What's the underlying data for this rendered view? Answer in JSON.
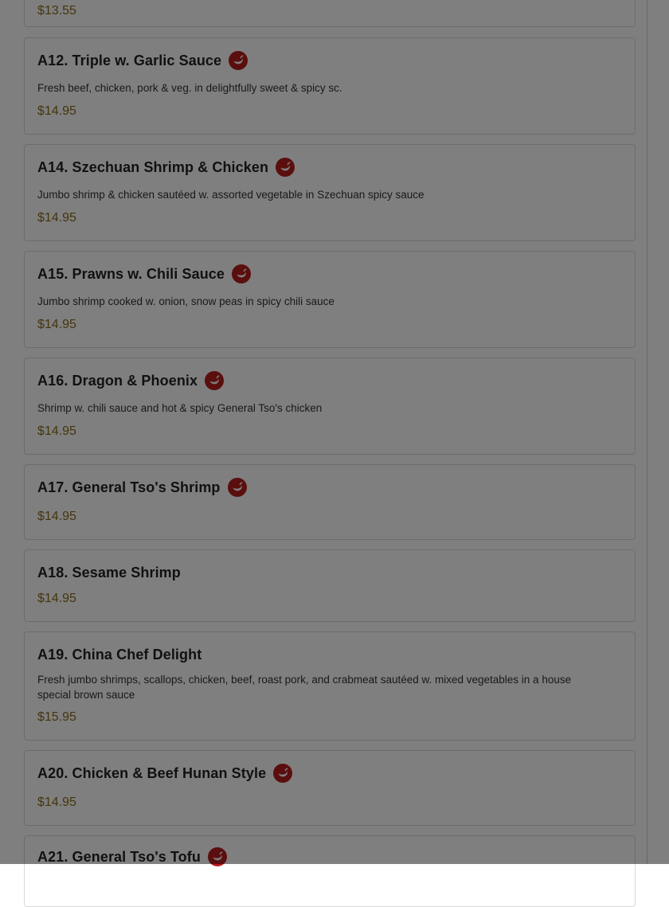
{
  "colors": {
    "price": "#8a6a1c",
    "spicy_icon": "#b71c1c",
    "overlay": "rgba(0,0,0,0.5)"
  },
  "menu": {
    "items": [
      {
        "name": "",
        "description": "",
        "price": "$13.55",
        "spicy": false
      },
      {
        "name": "A12. Triple w. Garlic Sauce",
        "description": "Fresh beef, chicken, pork & veg. in delightfully sweet & spicy sc.",
        "price": "$14.95",
        "spicy": true,
        "icon": "chili-pepper-icon"
      },
      {
        "name": "A14. Szechuan Shrimp & Chicken",
        "description": "Jumbo shrimp & chicken sautéed w. assorted vegetable in Szechuan spicy sauce",
        "price": "$14.95",
        "spicy": true,
        "icon": "chili-pepper-icon"
      },
      {
        "name": "A15. Prawns w. Chili Sauce",
        "description": "Jumbo shrimp cooked w. onion, snow peas in spicy chili sauce",
        "price": "$14.95",
        "spicy": true,
        "icon": "chili-pepper-icon"
      },
      {
        "name": "A16. Dragon & Phoenix",
        "description": "Shrimp w. chili sauce and hot & spicy General Tso's chicken",
        "price": "$14.95",
        "spicy": true,
        "icon": "chili-pepper-icon"
      },
      {
        "name": "A17. General Tso's Shrimp",
        "description": "",
        "price": "$14.95",
        "spicy": true,
        "icon": "chili-pepper-icon"
      },
      {
        "name": "A18. Sesame Shrimp",
        "description": "",
        "price": "$14.95",
        "spicy": false
      },
      {
        "name": "A19. China Chef Delight",
        "description": "Fresh jumbo shrimps, scallops, chicken, beef, roast pork, and crabmeat sautéed w. mixed vegetables in a house special brown sauce",
        "price": "$15.95",
        "spicy": false
      },
      {
        "name": "A20. Chicken & Beef Hunan Style",
        "description": "",
        "price": "$14.95",
        "spicy": true,
        "icon": "chili-pepper-icon"
      },
      {
        "name": "A21. General Tso's Tofu",
        "description": "",
        "price": "",
        "spicy": true,
        "icon": "chili-pepper-icon"
      }
    ]
  }
}
